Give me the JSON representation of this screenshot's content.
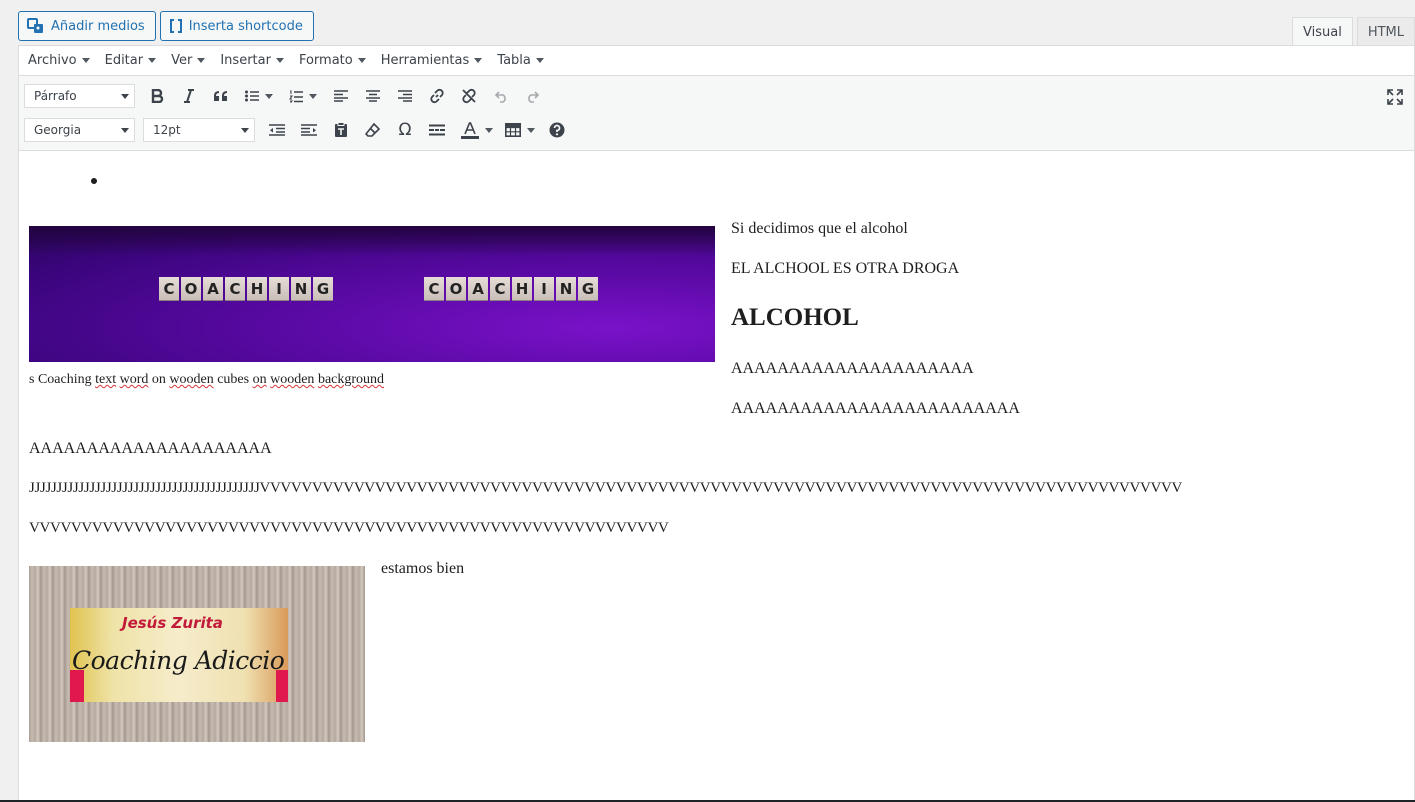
{
  "media_buttons": {
    "add_media": "Añadir medios",
    "insert_shortcode": "Inserta shortcode"
  },
  "tabs": [
    {
      "label": "Visual",
      "active": true
    },
    {
      "label": "HTML",
      "active": false
    }
  ],
  "menubar": [
    "Archivo",
    "Editar",
    "Ver",
    "Insertar",
    "Formato",
    "Herramientas",
    "Tabla"
  ],
  "toolbar": {
    "format_select": "Párrafo",
    "font_family_select": "Georgia",
    "font_size_select": "12pt",
    "row1_icons": [
      "bold-icon",
      "italic-icon",
      "blockquote-icon",
      "bullet-list-icon",
      "numbered-list-icon",
      "align-left-icon",
      "align-center-icon",
      "align-right-icon",
      "link-icon",
      "unlink-icon",
      "undo-icon",
      "redo-icon"
    ],
    "row2_icons": [
      "outdent-icon",
      "indent-icon",
      "paste-text-icon",
      "clear-formatting-icon",
      "special-character-icon",
      "horizontal-line-icon",
      "text-color-icon",
      "table-icon",
      "help-icon"
    ],
    "fullscreen_icon": "fullscreen-icon"
  },
  "content": {
    "image1_cubes_left": [
      "C",
      "O",
      "A",
      "C",
      "H",
      "I",
      "N",
      "G"
    ],
    "image1_cubes_right": [
      "C",
      "O",
      "A",
      "C",
      "H",
      "I",
      "N",
      "G"
    ],
    "image1_caption": {
      "parts": [
        "s Coaching ",
        "text",
        " ",
        "word",
        " on ",
        "wooden",
        " cubes ",
        "on",
        " ",
        "wooden",
        " ",
        "background"
      ]
    },
    "para_alcohol_intro": "Si decidimos que el alcohol",
    "para_droga": "EL ALCHOOL ES OTRA DROGA",
    "heading_alcohol": "ALCOHOL",
    "para_a1": "AAAAAAAAAAAAAAAAAAAAA",
    "para_a2": "AAAAAAAAAAAAAAAAAAAAAAAAA",
    "para_a3": "AAAAAAAAAAAAAAAAAAAAA",
    "para_jv": "JJJJJJJJJJJJJJJJJJJJJJJJJJJJJJJJJJJJJJJJJJVVVVVVVVVVVVVVVVVVVVVVVVVVVVVVVVVVVVVVVVVVVVVVVVVVVVVVVVVVVVVVVVVVVVVVVVVVVVVVVVVVVVVVVV",
    "para_v": "VVVVVVVVVVVVVVVVVVVVVVVVVVVVVVVVVVVVVVVVVVVVVVVVVVVVVVVVVVVVV",
    "image2_title": "Jesús Zurita",
    "image2_subtitle": "Coaching Adiccio",
    "para_estamos": "estamos bien"
  },
  "colors": {
    "accent": "#2271b1",
    "spellcheck": "#d63638"
  }
}
